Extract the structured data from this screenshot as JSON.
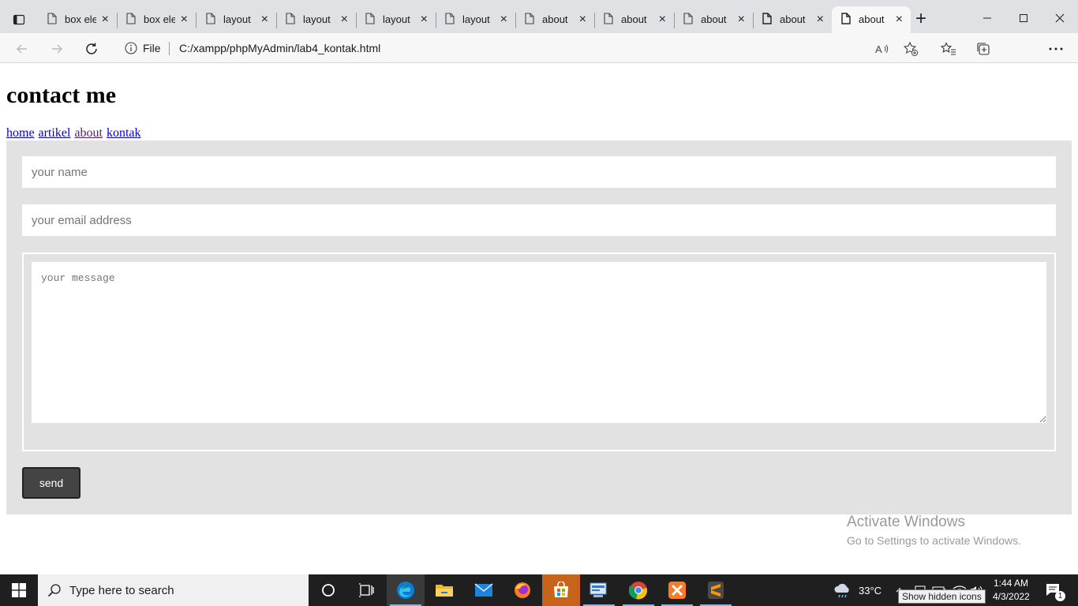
{
  "browser": {
    "tabs": [
      {
        "title": "box ele",
        "active": false
      },
      {
        "title": "box ele",
        "active": false
      },
      {
        "title": "layout",
        "active": false
      },
      {
        "title": "layout",
        "active": false
      },
      {
        "title": "layout",
        "active": false
      },
      {
        "title": "layout",
        "active": false
      },
      {
        "title": "about",
        "active": false
      },
      {
        "title": "about",
        "active": false
      },
      {
        "title": "about",
        "active": false
      },
      {
        "title": "about",
        "active": false
      },
      {
        "title": "about",
        "active": true
      }
    ],
    "new_tab": "+",
    "address": {
      "scheme_label": "File",
      "url": "C:/xampp/phpMyAdmin/lab4_kontak.html"
    }
  },
  "page": {
    "title": "contact me",
    "nav": [
      {
        "label": "home"
      },
      {
        "label": "artikel"
      },
      {
        "label": "about"
      },
      {
        "label": "kontak"
      }
    ],
    "form": {
      "name_placeholder": "your name",
      "email_placeholder": "your email address",
      "message_placeholder": "your message",
      "send_label": "send"
    },
    "watermark": {
      "title": "Activate Windows",
      "subtitle": "Go to Settings to activate Windows."
    }
  },
  "taskbar": {
    "search_placeholder": "Type here to search",
    "weather": "33°C",
    "time": "1:44 AM",
    "date": "4/3/2022",
    "tooltip": "Show hidden icons",
    "notification_count": "1",
    "apps": [
      "task-view",
      "edge",
      "file-explorer",
      "mail",
      "firefox",
      "store",
      "control-panel",
      "chrome",
      "xampp",
      "sublime-text"
    ]
  },
  "colors": {
    "accent": "#0078d4",
    "panel_bg": "#e2e2e2",
    "button_bg": "#444444"
  }
}
